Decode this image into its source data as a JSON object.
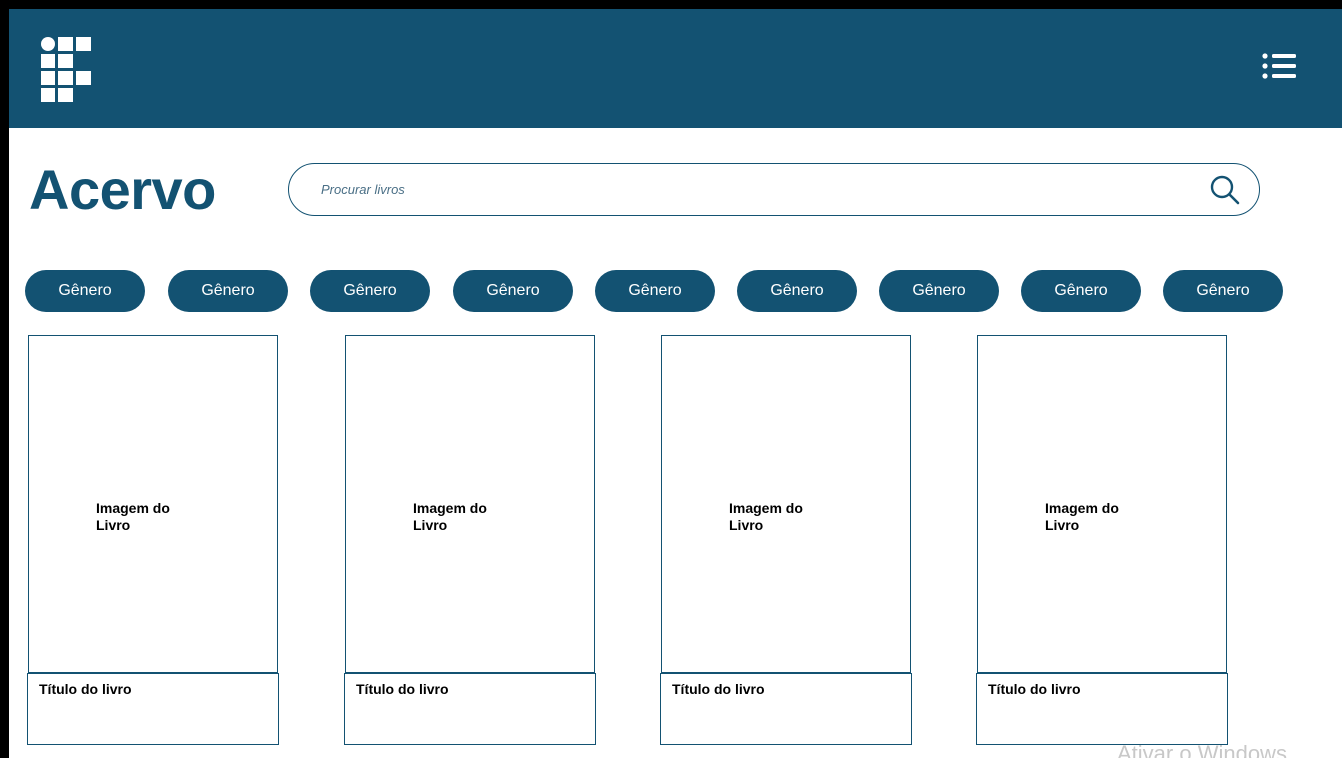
{
  "header": {
    "logo_icon": "institute-grid-logo",
    "menu_icon": "list-menu-icon",
    "background_color": "#135272"
  },
  "page": {
    "title": "Acervo"
  },
  "search": {
    "placeholder": "Procurar livros",
    "value": "",
    "icon": "search-icon"
  },
  "genres": [
    "Gênero",
    "Gênero",
    "Gênero",
    "Gênero",
    "Gênero",
    "Gênero",
    "Gênero",
    "Gênero",
    "Gênero"
  ],
  "books": [
    {
      "image_label": "Imagem do\nLivro",
      "title": "Título do livro"
    },
    {
      "image_label": "Imagem do\nLivro",
      "title": "Título do livro"
    },
    {
      "image_label": "Imagem do\nLivro",
      "title": "Título do livro"
    },
    {
      "image_label": "Imagem do\nLivro",
      "title": "Título do livro"
    }
  ],
  "system": {
    "watermark": "Ativar o Windows"
  },
  "colors": {
    "primary": "#135272",
    "on_primary": "#ffffff"
  }
}
